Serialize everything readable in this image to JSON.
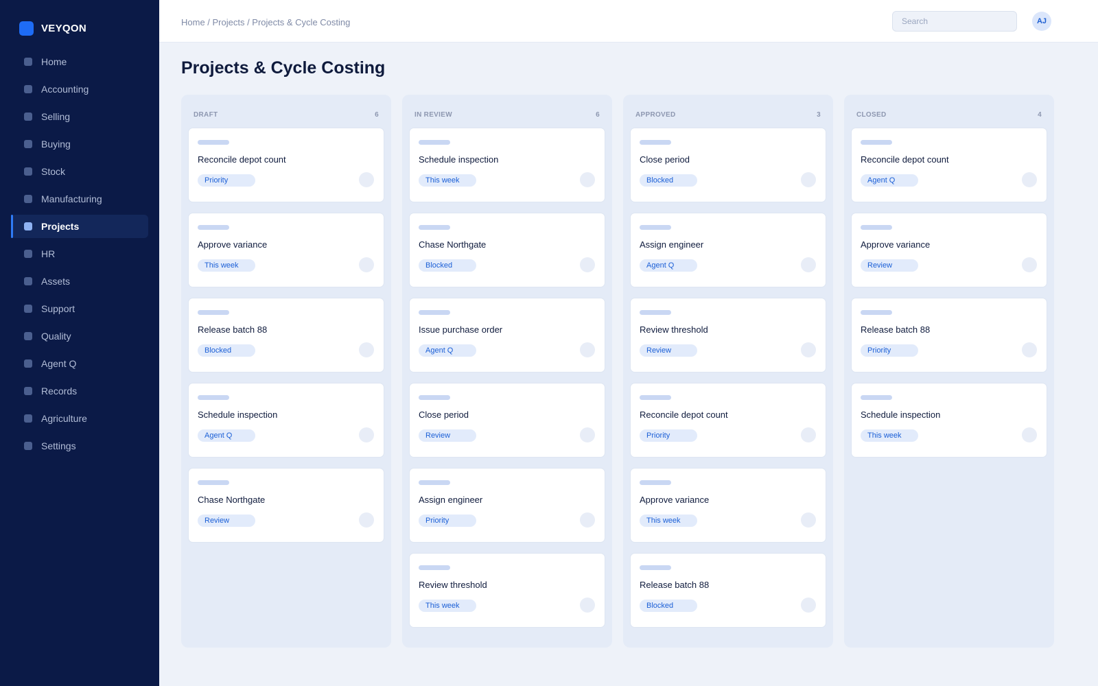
{
  "app": {
    "brand": "VEYQON"
  },
  "sidebar": {
    "items": [
      {
        "label": "Home",
        "active": false
      },
      {
        "label": "Accounting",
        "active": false
      },
      {
        "label": "Selling",
        "active": false
      },
      {
        "label": "Buying",
        "active": false
      },
      {
        "label": "Stock",
        "active": false
      },
      {
        "label": "Manufacturing",
        "active": false
      },
      {
        "label": "Projects",
        "active": true
      },
      {
        "label": "HR",
        "active": false
      },
      {
        "label": "Assets",
        "active": false
      },
      {
        "label": "Support",
        "active": false
      },
      {
        "label": "Quality",
        "active": false
      },
      {
        "label": "Agent Q",
        "active": false
      },
      {
        "label": "Records",
        "active": false
      },
      {
        "label": "Agriculture",
        "active": false
      },
      {
        "label": "Settings",
        "active": false
      }
    ]
  },
  "header": {
    "breadcrumb": "Home / Projects / Projects & Cycle Costing",
    "search_placeholder": "Search",
    "avatar_initials": "AJ"
  },
  "page": {
    "title": "Projects & Cycle Costing"
  },
  "colors": {
    "accent": "#1e6cf5",
    "sidebar_bg": "#0b1a47",
    "tag_text": "#1b5fd6",
    "tag_bg": "#e2ebfb"
  },
  "board": {
    "columns": [
      {
        "name": "DRAFT",
        "count": "6",
        "cards": [
          {
            "title": "Reconcile depot count",
            "tag": "Priority"
          },
          {
            "title": "Approve variance",
            "tag": "This week"
          },
          {
            "title": "Release batch 88",
            "tag": "Blocked"
          },
          {
            "title": "Schedule inspection",
            "tag": "Agent Q"
          },
          {
            "title": "Chase Northgate",
            "tag": "Review"
          }
        ]
      },
      {
        "name": "IN REVIEW",
        "count": "6",
        "cards": [
          {
            "title": "Schedule inspection",
            "tag": "This week"
          },
          {
            "title": "Chase Northgate",
            "tag": "Blocked"
          },
          {
            "title": "Issue purchase order",
            "tag": "Agent Q"
          },
          {
            "title": "Close period",
            "tag": "Review"
          },
          {
            "title": "Assign engineer",
            "tag": "Priority"
          },
          {
            "title": "Review threshold",
            "tag": "This week"
          }
        ]
      },
      {
        "name": "APPROVED",
        "count": "3",
        "cards": [
          {
            "title": "Close period",
            "tag": "Blocked"
          },
          {
            "title": "Assign engineer",
            "tag": "Agent Q"
          },
          {
            "title": "Review threshold",
            "tag": "Review"
          },
          {
            "title": "Reconcile depot count",
            "tag": "Priority"
          },
          {
            "title": "Approve variance",
            "tag": "This week"
          },
          {
            "title": "Release batch 88",
            "tag": "Blocked"
          }
        ]
      },
      {
        "name": "CLOSED",
        "count": "4",
        "cards": [
          {
            "title": "Reconcile depot count",
            "tag": "Agent Q"
          },
          {
            "title": "Approve variance",
            "tag": "Review"
          },
          {
            "title": "Release batch 88",
            "tag": "Priority"
          },
          {
            "title": "Schedule inspection",
            "tag": "This week"
          }
        ]
      }
    ]
  }
}
